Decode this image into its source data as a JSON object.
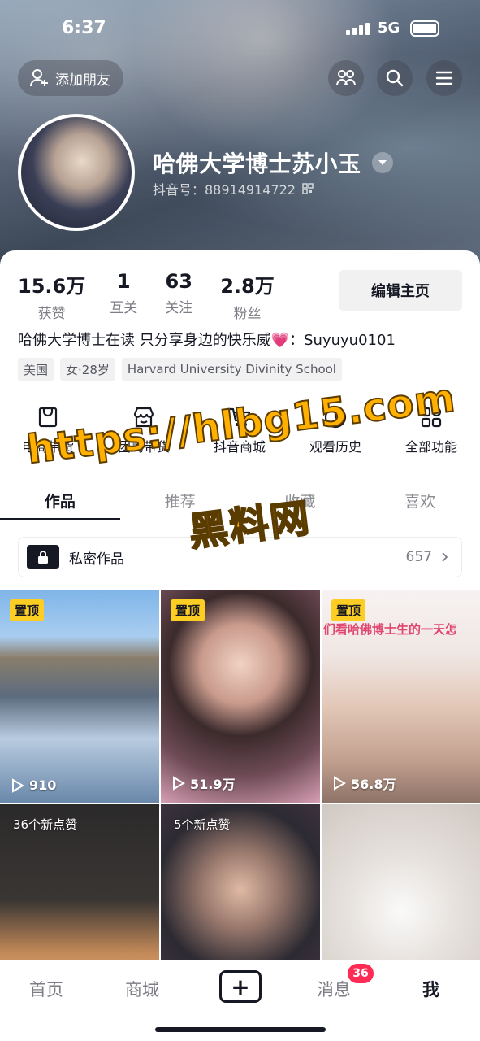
{
  "status": {
    "time": "6:37",
    "network": "5G"
  },
  "header": {
    "add_friend": "添加朋友",
    "name": "哈佛大学博士苏小玉",
    "douyin_id": "抖音号：88914914722"
  },
  "stats": [
    {
      "value": "15.6万",
      "label": "获赞"
    },
    {
      "value": "1",
      "label": "互关"
    },
    {
      "value": "63",
      "label": "关注"
    },
    {
      "value": "2.8万",
      "label": "粉丝"
    }
  ],
  "edit_button": "编辑主页",
  "bio": "哈佛大学博士在读 只分享身边的快乐威💗：Suyuyu0101",
  "tags": [
    "美国",
    "女·28岁",
    "Harvard University Divinity School"
  ],
  "tools": [
    {
      "label": "电商带货",
      "icon": "shopping-bag-icon"
    },
    {
      "label": "团购带货",
      "icon": "store-icon"
    },
    {
      "label": "抖音商城",
      "icon": "cart-icon"
    },
    {
      "label": "观看历史",
      "icon": "clock-icon"
    },
    {
      "label": "全部功能",
      "icon": "grid-icon"
    }
  ],
  "tabs": [
    "作品",
    "推荐",
    "收藏",
    "喜欢"
  ],
  "private_works": {
    "label": "私密作品",
    "count": "657"
  },
  "videos": [
    {
      "badge": "置顶",
      "plays": "910"
    },
    {
      "badge": "置顶",
      "plays": "51.9万"
    },
    {
      "badge": "置顶",
      "plays": "56.8万",
      "caption": "们看哈佛博士生的一天怎"
    },
    {
      "new_likes": "36个新点赞"
    },
    {
      "new_likes": "5个新点赞"
    },
    {}
  ],
  "nav": {
    "home": "首页",
    "mall": "商城",
    "messages": "消息",
    "messages_badge": "36",
    "me": "我"
  },
  "watermark": {
    "line1": "https://hlbg15.com",
    "line2": "黑料网"
  },
  "colors": {
    "accent": "#fe2c55",
    "pin": "#fccd23",
    "watermark": "#ffb000"
  }
}
